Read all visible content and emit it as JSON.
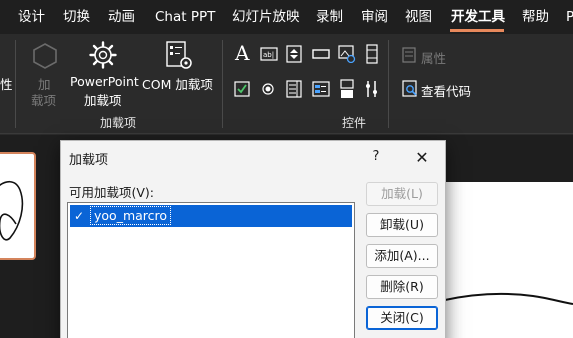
{
  "menubar": {
    "items": [
      "设计",
      "切换",
      "动画",
      "Chat PPT",
      "幻灯片放映",
      "录制",
      "审阅",
      "视图",
      "开发工具",
      "帮助",
      "P"
    ],
    "active_index": 8,
    "accent_color": "#e8895c"
  },
  "ribbon": {
    "left_cut_label": "性",
    "addins_disabled": {
      "line1": "加",
      "line2": "载项"
    },
    "powerpoint_addins": {
      "line1": "PowerPoint",
      "line2": "加载项"
    },
    "com_addins": "COM 加载项",
    "group_addins": "加载项",
    "properties": "属性",
    "view_code": "查看代码",
    "group_controls": "控件",
    "icons": [
      "gear-icon",
      "gear-settings-icon",
      "text-a-icon",
      "textbox-icon",
      "spinner-icon",
      "button-icon",
      "image-control-icon",
      "scrollbar-icon",
      "checkbox-icon",
      "radio-icon",
      "listbox-icon",
      "combobox-icon",
      "toggle-icon",
      "more-controls-icon",
      "properties-icon",
      "view-code-icon"
    ]
  },
  "dialog": {
    "title": "加载项",
    "help": "?",
    "close": "✕",
    "list_label": "可用加载项(V):",
    "items": [
      {
        "name": "yoo_marcro",
        "checked": true,
        "check_glyph": "✓"
      }
    ],
    "buttons": {
      "load": "加载(L)",
      "unload": "卸载(U)",
      "add": "添加(A)...",
      "remove": "删除(R)",
      "close": "关闭(C)"
    },
    "selection_color": "#0a64d6"
  }
}
